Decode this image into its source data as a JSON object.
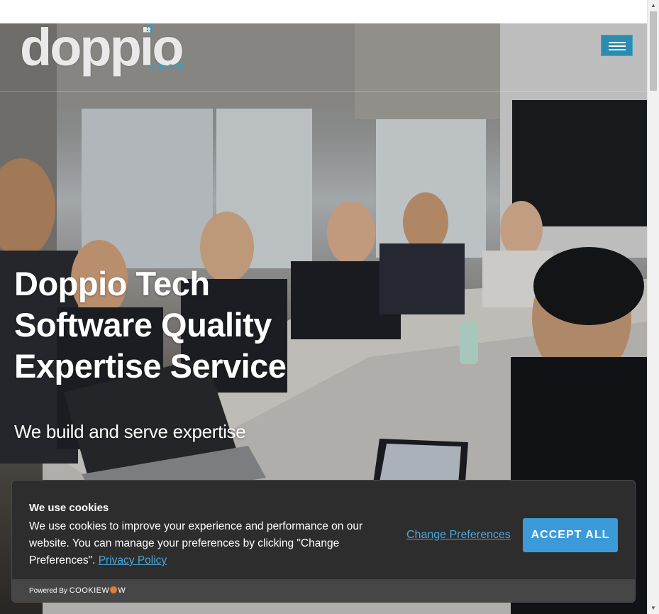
{
  "browser": {
    "scroll_up_glyph": "▲",
    "scroll_down_glyph": "▼"
  },
  "header": {
    "logo_text": "doppio",
    "logo_sub": "tech",
    "menu_icon": "hamburger-icon",
    "accent_color": "#2a8db0"
  },
  "hero": {
    "title_lines": [
      "Doppio Tech",
      "Software Quality",
      "Expertise Service"
    ],
    "subtitle": "We build and serve expertise"
  },
  "cookie_banner": {
    "title": "We use cookies",
    "text": "We use cookies to improve your experience and performance on our website. You can manage your preferences by clicking \"Change Preferences\".",
    "privacy_link": "Privacy Policy",
    "change_preferences": "Change Preferences",
    "accept_all": "ACCEPT ALL",
    "powered_by": "Powered By",
    "brand_left": "COOKIE",
    "brand_right": "W",
    "brand_w": "W",
    "link_color": "#4ba7da",
    "button_color": "#3b9bd8"
  }
}
